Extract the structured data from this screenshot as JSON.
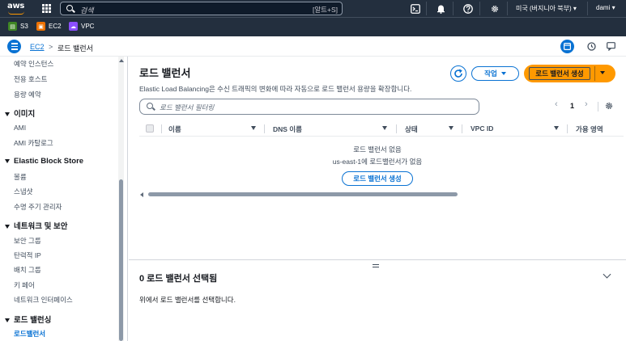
{
  "topnav": {
    "logo": "aws",
    "search_placeholder": "검색",
    "search_shortcut": "[알트+S]",
    "region": "미국 (버지니아 북부) ▾",
    "user": "dami ▾"
  },
  "services": [
    {
      "label": "S3",
      "color": "#3f8624"
    },
    {
      "label": "EC2",
      "color": "#ed7100"
    },
    {
      "label": "VPC",
      "color": "#8c4fff"
    }
  ],
  "breadcrumb": {
    "root": "EC2",
    "separator": ">",
    "current": "로드 밸런서"
  },
  "sidebar": {
    "items_top": [
      "예약 인스턴스",
      "전용 호스트",
      "용량 예약"
    ],
    "sections": [
      {
        "title": "이미지",
        "items": [
          "AMI",
          "AMI 카탈로그"
        ]
      },
      {
        "title": "Elastic Block Store",
        "items": [
          "볼륨",
          "스냅샷",
          "수명 주기 관리자"
        ]
      },
      {
        "title": "네트워크 및 보안",
        "items": [
          "보안 그룹",
          "탄력적 IP",
          "배치 그룹",
          "키 페어",
          "네트워크 인터페이스"
        ]
      },
      {
        "title": "로드 밸런싱",
        "items": [
          "로드밸런서"
        ]
      }
    ]
  },
  "main": {
    "title": "로드 밸런서",
    "description": "Elastic Load Balancing은 수신 트래픽의 변화에 따라 자동으로 로드 밸런서 용량을 확장합니다.",
    "action_label": "작업",
    "create_label": "로드 밸런서 생성",
    "filter_placeholder": "로드 밸런서 필터링",
    "page_number": "1",
    "columns": [
      "이름",
      "DNS 이름",
      "상태",
      "VPC ID",
      "가용 영역"
    ],
    "empty_title": "로드 밸런서 없음",
    "empty_subtitle": "us-east-1에 로드밸런서가 없음",
    "empty_button": "로드 밸런서 생성"
  },
  "split_panel": {
    "title": "0 로드 밸런서 선택됨",
    "message": "위에서 로드 밸런서를 선택합니다."
  }
}
